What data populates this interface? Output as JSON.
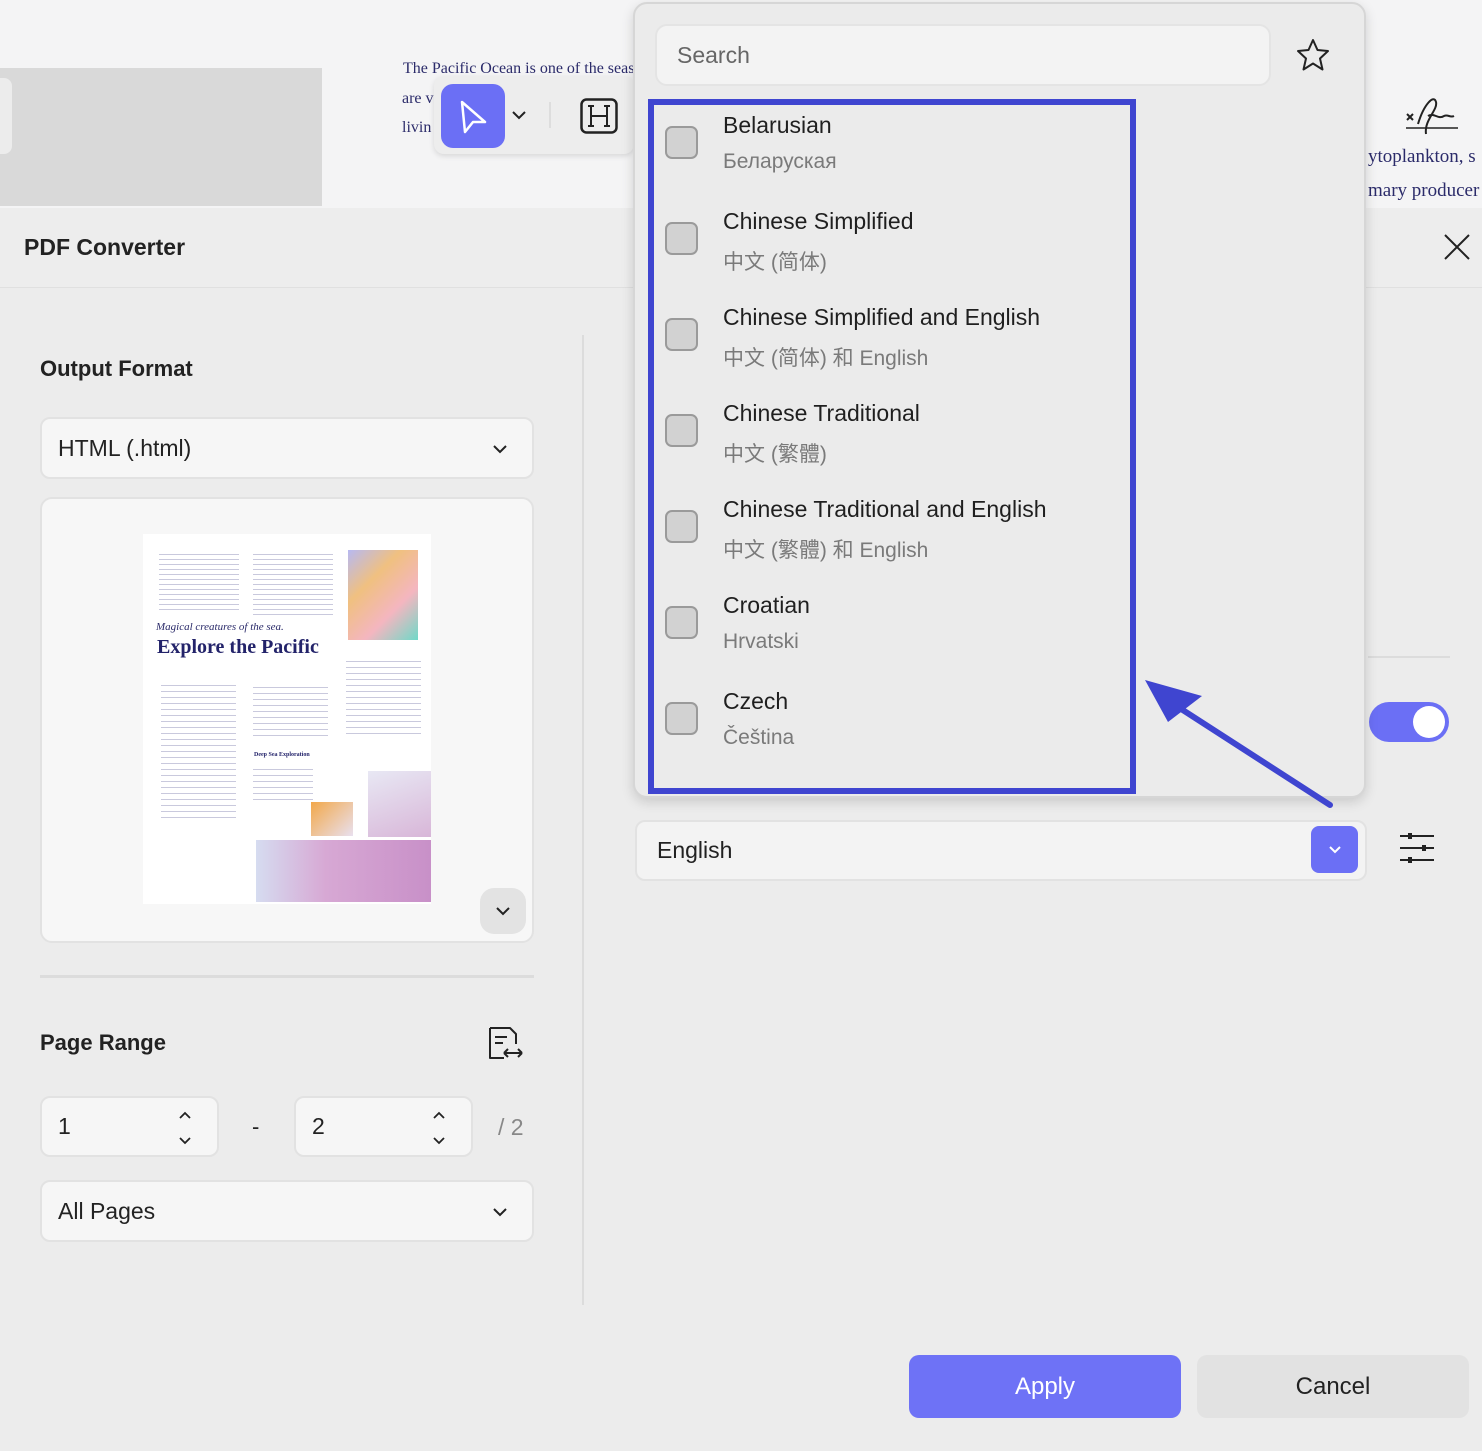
{
  "document": {
    "line1": "The Pacific Ocean is one of the seas",
    "line2": "are v",
    "line3": "livin",
    "right_line1": "ytoplankton, s",
    "right_line2": "mary producer"
  },
  "toolbar": {
    "select_tool": "cursor-icon",
    "heading_tool": "heading-icon",
    "signature_tool": "signature-icon"
  },
  "panel": {
    "title": "PDF Converter"
  },
  "output_format": {
    "label": "Output Format",
    "value": "HTML (.html)"
  },
  "preview": {
    "subtitle": "Magical creatures of the sea.",
    "title": "Explore the Pacific",
    "section": "Deep Sea Exploration"
  },
  "page_range": {
    "label": "Page Range",
    "from": "1",
    "separator": "-",
    "to": "2",
    "total": "/ 2",
    "mode": "All Pages"
  },
  "language_popup": {
    "search_placeholder": "Search",
    "items": [
      {
        "name": "Belarusian",
        "native": "Беларуская",
        "checked": false
      },
      {
        "name": "Chinese Simplified",
        "native": "中文 (简体)",
        "checked": false
      },
      {
        "name": "Chinese Simplified and English",
        "native": "中文 (简体) 和 English",
        "checked": false
      },
      {
        "name": "Chinese Traditional",
        "native": "中文 (繁體)",
        "checked": false
      },
      {
        "name": "Chinese Traditional and English",
        "native": "中文 (繁體) 和 English",
        "checked": false
      },
      {
        "name": "Croatian",
        "native": "Hrvatski",
        "checked": false
      },
      {
        "name": "Czech",
        "native": "Čeština",
        "checked": false
      }
    ]
  },
  "ocr": {
    "language": "English",
    "toggle_on": true
  },
  "buttons": {
    "apply": "Apply",
    "cancel": "Cancel"
  },
  "colors": {
    "accent": "#6b6ff5",
    "highlight": "#3f45d0"
  }
}
